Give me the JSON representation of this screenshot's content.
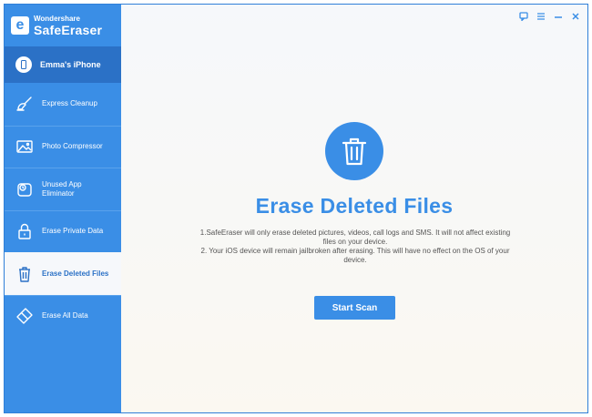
{
  "app": {
    "brand_sub": "Wondershare",
    "brand_main": "SafeEraser",
    "logo_letter": "e"
  },
  "device": {
    "name": "Emma's iPhone"
  },
  "sidebar": {
    "items": [
      {
        "label": "Express Cleanup",
        "icon": "broom-icon",
        "active": false
      },
      {
        "label": "Photo Compressor",
        "icon": "photo-icon",
        "active": false
      },
      {
        "label": "Unused App\nEliminator",
        "icon": "app-icon",
        "active": false
      },
      {
        "label": "Erase Private Data",
        "icon": "lock-icon",
        "active": false
      },
      {
        "label": "Erase Deleted Files",
        "icon": "trash-icon",
        "active": true
      },
      {
        "label": "Erase All Data",
        "icon": "eraser-icon",
        "active": false
      }
    ]
  },
  "titlebar": {
    "feedback_icon": "feedback-icon",
    "menu_icon": "menu-icon",
    "minimize_icon": "minimize-icon",
    "close_icon": "close-icon"
  },
  "main": {
    "title": "Erase Deleted Files",
    "desc_line1": "1.SafeEraser will only erase deleted pictures, videos, call logs and SMS. It will not affect existing files on your device.",
    "desc_line2": "2. Your iOS device will remain jailbroken after erasing. This will have no effect on the OS of your device.",
    "button_label": "Start Scan"
  },
  "colors": {
    "accent": "#3a8ee6",
    "sidebar_dark": "#2b71c6",
    "background": "#f6f8fb"
  }
}
